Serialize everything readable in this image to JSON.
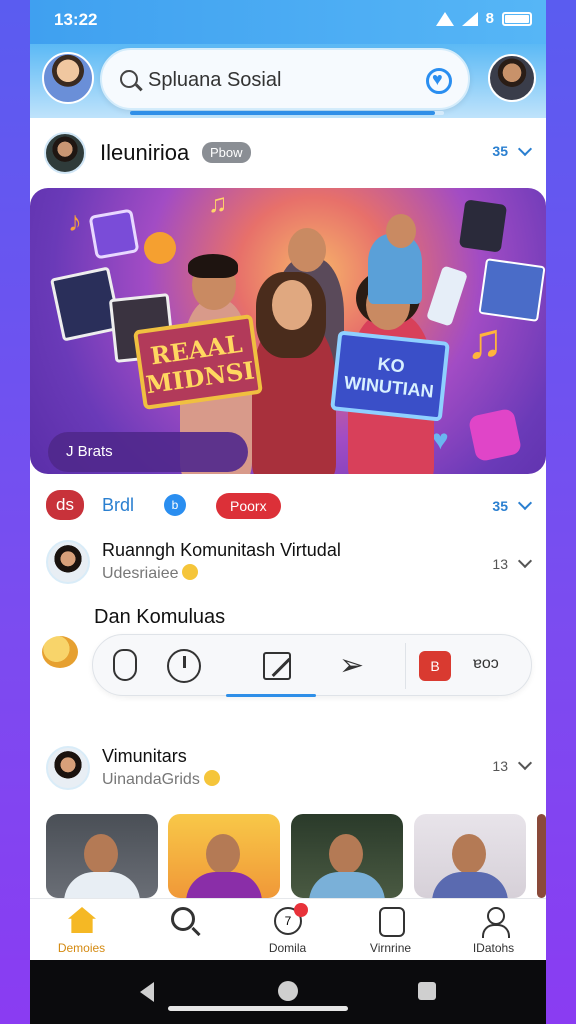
{
  "status": {
    "time": "13:22",
    "extra": "8"
  },
  "search": {
    "text": "Spluana Sosial",
    "progress": 0.97
  },
  "post": {
    "name": "Ileunirioa",
    "badge": "Pbow",
    "count": "35"
  },
  "hero": {
    "sign_left": "REAAL MIDNSI",
    "sign_right": "KO WINUTIAN",
    "badge": "J Brats"
  },
  "tags": {
    "red": "ds",
    "blue_text": "Brdl",
    "blue_icon": "b",
    "red2": "Poorx",
    "count": "35"
  },
  "comments": [
    {
      "title": "Ruanngh Komunitash Virtudal",
      "sub": "Udesriaiee",
      "count": "13"
    },
    {
      "title": "Vimunitars",
      "sub": "UinandaGrids",
      "count": "13"
    }
  ],
  "section_label": "Dan Komuluas",
  "toolbar": {
    "badge": "B",
    "more": "ɐoɔ"
  },
  "nav": [
    {
      "label": "Demoies",
      "icon": "home-icon",
      "active": true
    },
    {
      "label": "",
      "icon": "search-icon",
      "active": false
    },
    {
      "label": "Domila",
      "icon": "notification-icon",
      "badge_text": "7",
      "active": false
    },
    {
      "label": "Virnrine",
      "icon": "device-icon",
      "active": false
    },
    {
      "label": "IDatohs",
      "icon": "profile-icon",
      "active": false
    }
  ],
  "colors": {
    "accent": "#2f8fe8",
    "brand_red": "#dc3038",
    "active_nav": "#d48a12"
  }
}
